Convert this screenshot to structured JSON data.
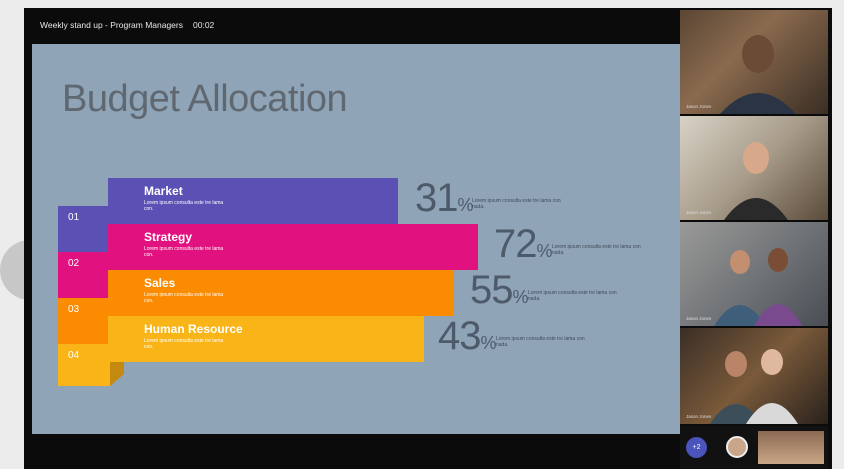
{
  "meeting": {
    "title": "Weekly stand up - Program Managers",
    "timer": "00:02"
  },
  "slide": {
    "title": "Budget Allocation",
    "rows": [
      {
        "number": "01",
        "name": "Market",
        "desc": "Lorem ipsum consulta este tre lama con.",
        "percent": "31",
        "percent_desc": "Lorem ipsum consulta este tre lama con nada.",
        "band_color": "#5b50b4",
        "tab_color": "#5b50b4"
      },
      {
        "number": "02",
        "name": "Strategy",
        "desc": "Lorem ipsum consulta este tre lama con.",
        "percent": "72",
        "percent_desc": "Lorem ipsum consulta este tre lama con nada.",
        "band_color": "#e1117f",
        "tab_color": "#e1117f"
      },
      {
        "number": "03",
        "name": "Sales",
        "desc": "Lorem ipsum consulta este tre lama con.",
        "percent": "55",
        "percent_desc": "Lorem ipsum consulta este tre lama con nada.",
        "band_color": "#fb8b00",
        "tab_color": "#fb8b00"
      },
      {
        "number": "04",
        "name": "Human Resource",
        "desc": "Lorem ipsum consulta este tre lama con.",
        "percent": "43",
        "percent_desc": "Lorem ipsum consulta este tre lama con nada.",
        "band_color": "#f9b418",
        "tab_color": "#f9b418"
      }
    ],
    "percent_sign": "%"
  },
  "participants": [
    {
      "label": "Jason Jones"
    },
    {
      "label": "Jason Jones"
    },
    {
      "label": "Jason Jones"
    },
    {
      "label": "Jason Jones"
    }
  ],
  "overflow": {
    "count_label": "+2"
  }
}
